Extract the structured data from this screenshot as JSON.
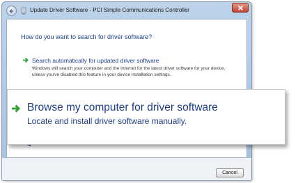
{
  "window": {
    "title": "Update Driver Software - PCI Simple Communications Controller"
  },
  "main": {
    "heading": "How do you want to search for driver software?",
    "option_auto": {
      "title": "Search automatically for updated driver software",
      "description": "Windows will search your computer and the Internet for the latest driver software for your device, unless you've disabled this feature in your device installation settings."
    }
  },
  "callout": {
    "title": "Browse my computer for driver software",
    "subtitle": "Locate and install driver software manually."
  },
  "footer": {
    "cancel_label": "Cancel"
  },
  "icons": {
    "back": "back-arrow-icon",
    "title": "device-driver-icon",
    "close": "close-icon",
    "option_arrow": "green-arrow-icon"
  },
  "colors": {
    "link_blue": "#1b3e86",
    "arrow_green": "#2e9e2e",
    "close_red": "#c0422e"
  }
}
